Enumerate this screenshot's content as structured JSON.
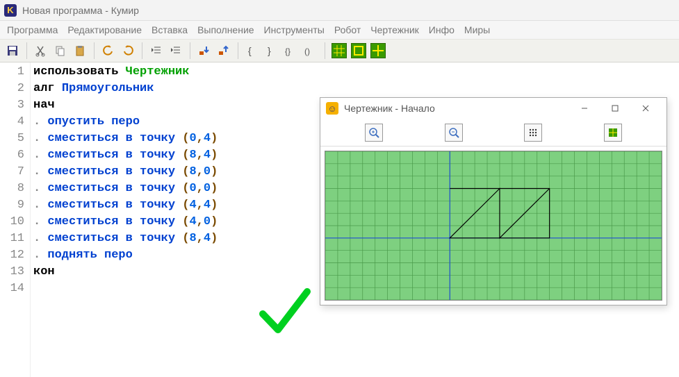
{
  "window": {
    "title": "Новая программа - Кумир",
    "icon_letter": "K"
  },
  "menu": {
    "items": [
      "Программа",
      "Редактирование",
      "Вставка",
      "Выполнение",
      "Инструменты",
      "Робот",
      "Чертежник",
      "Инфо",
      "Миры"
    ]
  },
  "toolbar": {
    "icons": [
      "save-icon",
      "cut-icon",
      "copy-icon",
      "paste-icon",
      "undo-icon",
      "redo-icon",
      "outdent-icon",
      "indent-icon",
      "step-into-icon",
      "step-over-icon",
      "brace-open-icon",
      "brace-close-icon",
      "brace-pair-icon",
      "brace-alt-icon",
      "grid-a-icon",
      "grid-b-icon",
      "grid-c-icon"
    ]
  },
  "code": {
    "lines": [
      {
        "n": "1",
        "tokens": [
          [
            "kw-black",
            "использовать "
          ],
          [
            "kw-green",
            "Чертежник"
          ]
        ]
      },
      {
        "n": "2",
        "tokens": [
          [
            "kw-black",
            "алг "
          ],
          [
            "kw-blue",
            "Прямоугольник"
          ]
        ]
      },
      {
        "n": "3",
        "tokens": [
          [
            "kw-black",
            "нач"
          ]
        ]
      },
      {
        "n": "4",
        "tokens": [
          [
            "kw-gray",
            ". "
          ],
          [
            "kw-blue",
            "опустить перо"
          ]
        ]
      },
      {
        "n": "5",
        "tokens": [
          [
            "kw-gray",
            ". "
          ],
          [
            "kw-blue",
            "сместиться в точку "
          ],
          [
            "paren",
            "("
          ],
          [
            "num",
            "0"
          ],
          [
            "comma",
            ","
          ],
          [
            "num",
            "4"
          ],
          [
            "paren",
            ")"
          ]
        ]
      },
      {
        "n": "6",
        "tokens": [
          [
            "kw-gray",
            ". "
          ],
          [
            "kw-blue",
            "сместиться в точку "
          ],
          [
            "paren",
            "("
          ],
          [
            "num",
            "8"
          ],
          [
            "comma",
            ","
          ],
          [
            "num",
            "4"
          ],
          [
            "paren",
            ")"
          ]
        ]
      },
      {
        "n": "7",
        "tokens": [
          [
            "kw-gray",
            ". "
          ],
          [
            "kw-blue",
            "сместиться в точку "
          ],
          [
            "paren",
            "("
          ],
          [
            "num",
            "8"
          ],
          [
            "comma",
            ","
          ],
          [
            "num",
            "0"
          ],
          [
            "paren",
            ")"
          ]
        ]
      },
      {
        "n": "8",
        "tokens": [
          [
            "kw-gray",
            ". "
          ],
          [
            "kw-blue",
            "сместиться в точку "
          ],
          [
            "paren",
            "("
          ],
          [
            "num",
            "0"
          ],
          [
            "comma",
            ","
          ],
          [
            "num",
            "0"
          ],
          [
            "paren",
            ")"
          ]
        ]
      },
      {
        "n": "9",
        "tokens": [
          [
            "kw-gray",
            ". "
          ],
          [
            "kw-blue",
            "сместиться в точку "
          ],
          [
            "paren",
            "("
          ],
          [
            "num",
            "4"
          ],
          [
            "comma",
            ","
          ],
          [
            "num",
            "4"
          ],
          [
            "paren",
            ")"
          ]
        ]
      },
      {
        "n": "10",
        "tokens": [
          [
            "kw-gray",
            ". "
          ],
          [
            "kw-blue",
            "сместиться в точку "
          ],
          [
            "paren",
            "("
          ],
          [
            "num",
            "4"
          ],
          [
            "comma",
            ","
          ],
          [
            "num",
            "0"
          ],
          [
            "paren",
            ")"
          ]
        ]
      },
      {
        "n": "11",
        "tokens": [
          [
            "kw-gray",
            ". "
          ],
          [
            "kw-blue",
            "сместиться в точку "
          ],
          [
            "paren",
            "("
          ],
          [
            "num",
            "8"
          ],
          [
            "comma",
            ","
          ],
          [
            "num",
            "4"
          ],
          [
            "paren",
            ")"
          ]
        ]
      },
      {
        "n": "12",
        "tokens": [
          [
            "kw-gray",
            ". "
          ],
          [
            "kw-blue",
            "поднять перо"
          ]
        ]
      },
      {
        "n": "13",
        "tokens": [
          [
            "kw-black",
            "кон"
          ]
        ]
      },
      {
        "n": "14",
        "tokens": []
      }
    ]
  },
  "drafter": {
    "title": "Чертежник - Начало",
    "icon_glyph": "☺",
    "toolbar_icons": [
      "zoom-in-icon",
      "zoom-out-icon",
      "grid-toggle-icon",
      "fit-icon"
    ],
    "canvas": {
      "cell": 18,
      "cols": 27,
      "rows": 12,
      "axis_x_row": 7,
      "axis_y_col": 10,
      "path_points": [
        [
          0,
          4
        ],
        [
          8,
          4
        ],
        [
          8,
          0
        ],
        [
          0,
          0
        ],
        [
          4,
          4
        ],
        [
          4,
          0
        ],
        [
          8,
          4
        ]
      ]
    }
  },
  "checkmark_color": "#00d020"
}
